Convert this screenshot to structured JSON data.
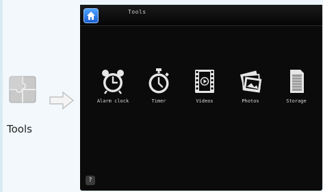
{
  "explainer": {
    "caption": "Tools",
    "icon": "puzzle-icon",
    "arrow": "arrow-right-icon"
  },
  "screen": {
    "title": "Tools",
    "home_icon": "home-icon",
    "help_label": "?",
    "tools": [
      {
        "label": "Alarm clock",
        "icon": "alarm-clock-icon"
      },
      {
        "label": "Timer",
        "icon": "stopwatch-icon"
      },
      {
        "label": "Videos",
        "icon": "video-film-icon"
      },
      {
        "label": "Photos",
        "icon": "photos-icon"
      },
      {
        "label": "Storage",
        "icon": "storage-icon"
      }
    ]
  },
  "colors": {
    "screen_bg": "#0b0b0b",
    "accent_blue": "#1a5fd0",
    "icon_fg": "#e6e6e6"
  }
}
